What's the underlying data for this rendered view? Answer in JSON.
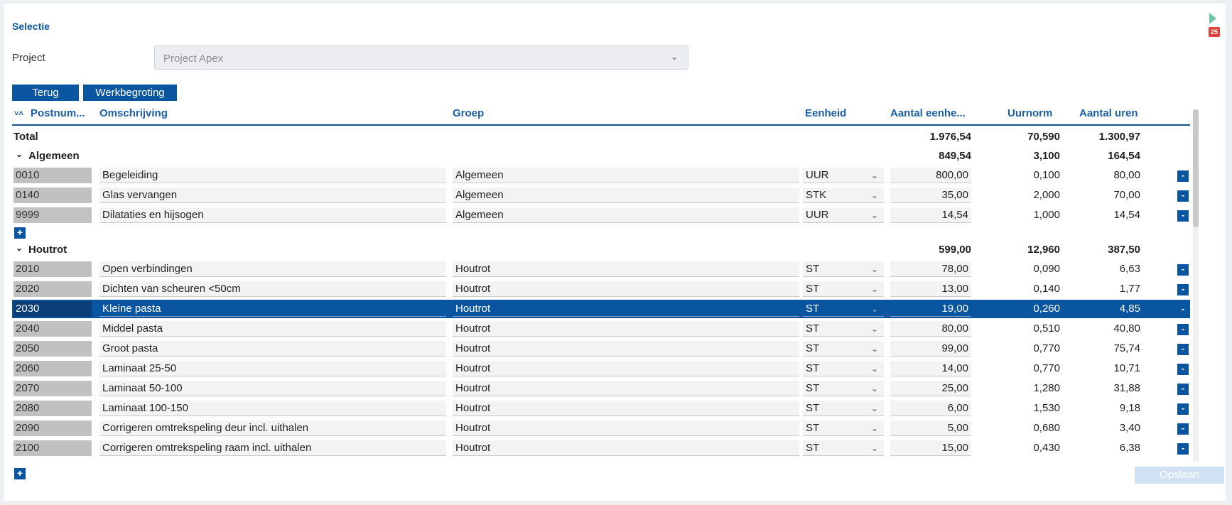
{
  "selection": {
    "title": "Selectie",
    "project_label": "Project",
    "project_value": "Project Apex"
  },
  "buttons": {
    "back": "Terug",
    "budget": "Werkbegroting",
    "save": "Opslaan"
  },
  "badge_count": "25",
  "columns": {
    "number": "Postnum...",
    "description": "Omschrijving",
    "group": "Groep",
    "unit": "Eenheid",
    "quantity": "Aantal eenhe...",
    "norm": "Uurnorm",
    "hours": "Aantal uren"
  },
  "total": {
    "label": "Total",
    "quantity": "1.976,54",
    "norm": "70,590",
    "hours": "1.300,97"
  },
  "groups": [
    {
      "name": "Algemeen",
      "quantity": "849,54",
      "norm": "3,100",
      "hours": "164,54",
      "rows": [
        {
          "number": "0010",
          "description": "Begeleiding",
          "group": "Algemeen",
          "unit": "UUR",
          "quantity": "800,00",
          "norm": "0,100",
          "hours": "80,00"
        },
        {
          "number": "0140",
          "description": "Glas vervangen",
          "group": "Algemeen",
          "unit": "STK",
          "quantity": "35,00",
          "norm": "2,000",
          "hours": "70,00"
        },
        {
          "number": "9999",
          "description": "Dilataties en hijsogen",
          "group": "Algemeen",
          "unit": "UUR",
          "quantity": "14,54",
          "norm": "1,000",
          "hours": "14,54"
        }
      ]
    },
    {
      "name": "Houtrot",
      "quantity": "599,00",
      "norm": "12,960",
      "hours": "387,50",
      "rows": [
        {
          "number": "2010",
          "description": "Open verbindingen",
          "group": "Houtrot",
          "unit": "ST",
          "quantity": "78,00",
          "norm": "0,090",
          "hours": "6,63"
        },
        {
          "number": "2020",
          "description": "Dichten van scheuren <50cm",
          "group": "Houtrot",
          "unit": "ST",
          "quantity": "13,00",
          "norm": "0,140",
          "hours": "1,77"
        },
        {
          "number": "2030",
          "description": "Kleine pasta",
          "group": "Houtrot",
          "unit": "ST",
          "quantity": "19,00",
          "norm": "0,260",
          "hours": "4,85"
        },
        {
          "number": "2040",
          "description": "Middel pasta",
          "group": "Houtrot",
          "unit": "ST",
          "quantity": "80,00",
          "norm": "0,510",
          "hours": "40,80"
        },
        {
          "number": "2050",
          "description": "Groot pasta",
          "group": "Houtrot",
          "unit": "ST",
          "quantity": "99,00",
          "norm": "0,770",
          "hours": "75,74"
        },
        {
          "number": "2060",
          "description": "Laminaat 25-50",
          "group": "Houtrot",
          "unit": "ST",
          "quantity": "14,00",
          "norm": "0,770",
          "hours": "10,71"
        },
        {
          "number": "2070",
          "description": "Laminaat 50-100",
          "group": "Houtrot",
          "unit": "ST",
          "quantity": "25,00",
          "norm": "1,280",
          "hours": "31,88"
        },
        {
          "number": "2080",
          "description": "Laminaat 100-150",
          "group": "Houtrot",
          "unit": "ST",
          "quantity": "6,00",
          "norm": "1,530",
          "hours": "9,18"
        },
        {
          "number": "2090",
          "description": "Corrigeren omtrekspeling deur incl. uithalen",
          "group": "Houtrot",
          "unit": "ST",
          "quantity": "5,00",
          "norm": "0,680",
          "hours": "3,40"
        },
        {
          "number": "2100",
          "description": "Corrigeren omtrekspeling raam incl. uithalen",
          "group": "Houtrot",
          "unit": "ST",
          "quantity": "15,00",
          "norm": "0,430",
          "hours": "6,38"
        }
      ]
    }
  ]
}
